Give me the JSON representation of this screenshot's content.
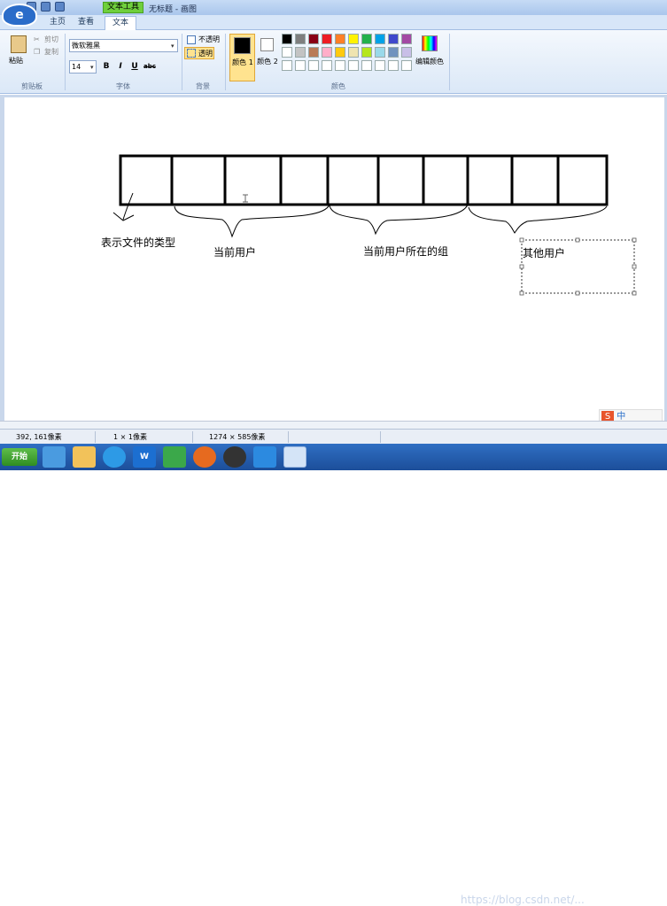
{
  "title_bar": {
    "context_tab": "文本工具",
    "title": "无标题 - 画图"
  },
  "tabs": [
    {
      "label": "主页"
    },
    {
      "label": "查看"
    },
    {
      "label": "文本"
    }
  ],
  "ribbon": {
    "clipboard": {
      "paste": "粘贴",
      "cut": "剪切",
      "copy": "复制",
      "group_label": "剪贴板"
    },
    "font": {
      "family": "微软雅黑",
      "size": "14",
      "bold": "B",
      "italic": "I",
      "underline": "U",
      "strike": "abc",
      "group_label": "字体"
    },
    "background": {
      "opaque": "不透明",
      "transparent": "透明",
      "group_label": "背景"
    },
    "colors": {
      "color1": "颜色 1",
      "color2": "颜色 2",
      "edit_colors": "编辑颜色",
      "group_label": "颜色",
      "palette_row1": [
        "#000000",
        "#7f7f7f",
        "#880015",
        "#ed1c24",
        "#ff7f27",
        "#fff200",
        "#22b14c",
        "#00a2e8",
        "#3f48cc",
        "#a349a4"
      ],
      "palette_row2": [
        "#ffffff",
        "#c3c3c3",
        "#b97a57",
        "#ffaec9",
        "#ffc90e",
        "#efe4b0",
        "#b5e61d",
        "#99d9ea",
        "#7092be",
        "#c8bfe7"
      ]
    }
  },
  "canvas": {
    "labels": {
      "file_type": "表示文件的类型",
      "owner": "当前用户",
      "group": "当前用户所在的组",
      "others": "其他用户"
    }
  },
  "status": {
    "cursor": "392, 161像素",
    "selection": "1 × 1像素",
    "image_size": "1274 × 585像素"
  },
  "taskbar": {
    "start": "开始",
    "ime_label": "中"
  },
  "watermark": "https://blog.csdn.net/..."
}
